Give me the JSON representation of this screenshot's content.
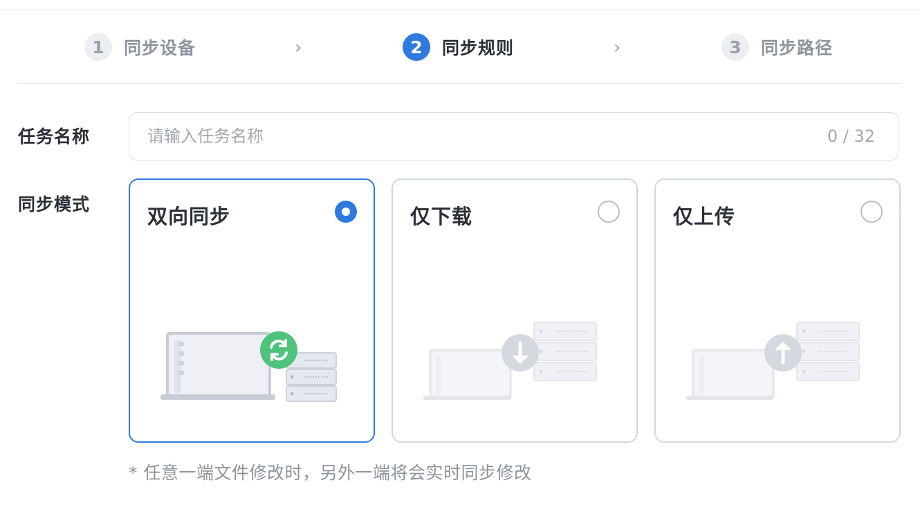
{
  "steps": [
    {
      "number": "1",
      "label": "同步设备",
      "state": "done"
    },
    {
      "number": "2",
      "label": "同步规则",
      "state": "active"
    },
    {
      "number": "3",
      "label": "同步路径",
      "state": "pending"
    }
  ],
  "step_separator": "›",
  "form": {
    "task_name_label": "任务名称",
    "task_name_value": "",
    "task_name_placeholder": "请输入任务名称",
    "task_name_count": "0 / 32",
    "sync_mode_label": "同步模式"
  },
  "modes": [
    {
      "title": "双向同步",
      "selected": true,
      "icon": "sync-icon"
    },
    {
      "title": "仅下载",
      "selected": false,
      "icon": "download-arrow-icon"
    },
    {
      "title": "仅上传",
      "selected": false,
      "icon": "upload-arrow-icon"
    }
  ],
  "hint": "* 任意一端文件修改时，另外一端将会实时同步修改",
  "colors": {
    "accent": "#2f7ade",
    "sync_green": "#4fc27c",
    "text_primary": "#2b2f36",
    "text_muted": "#8e949d",
    "border": "#d3d7df"
  }
}
